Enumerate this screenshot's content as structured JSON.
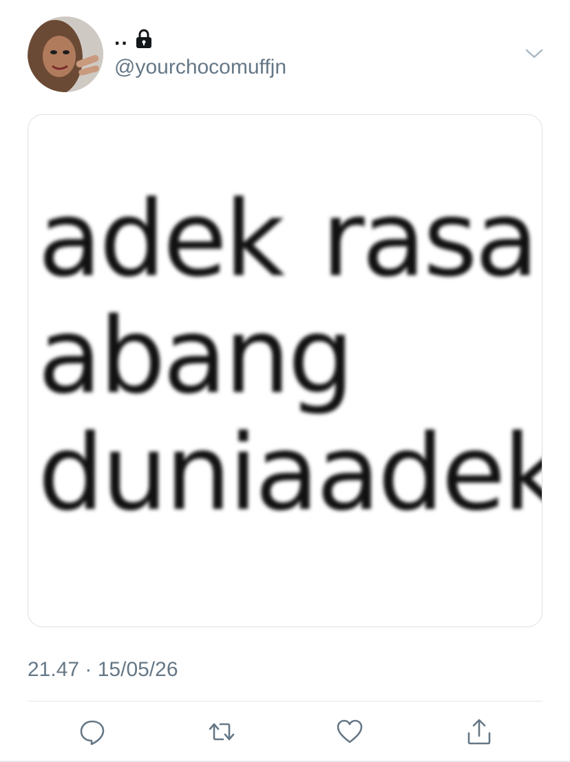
{
  "user": {
    "display_name": "..",
    "handle": "@yourchocomuffjn",
    "protected_icon": "lock-icon",
    "avatar_icon": "avatar"
  },
  "tweet": {
    "image_text_lines": [
      [
        "adek",
        "rasa"
      ],
      [
        "abang"
      ],
      [
        "dunia",
        "adek"
      ]
    ],
    "timestamp": "21.47 · 15/05/26"
  },
  "actions": {
    "reply_icon": "reply-icon",
    "retweet_icon": "retweet-icon",
    "like_icon": "heart-icon",
    "share_icon": "share-icon",
    "more_icon": "chevron-down-icon"
  },
  "colors": {
    "secondary_text": "#657786",
    "divider": "#e1e8ed",
    "icon": "#657786"
  }
}
